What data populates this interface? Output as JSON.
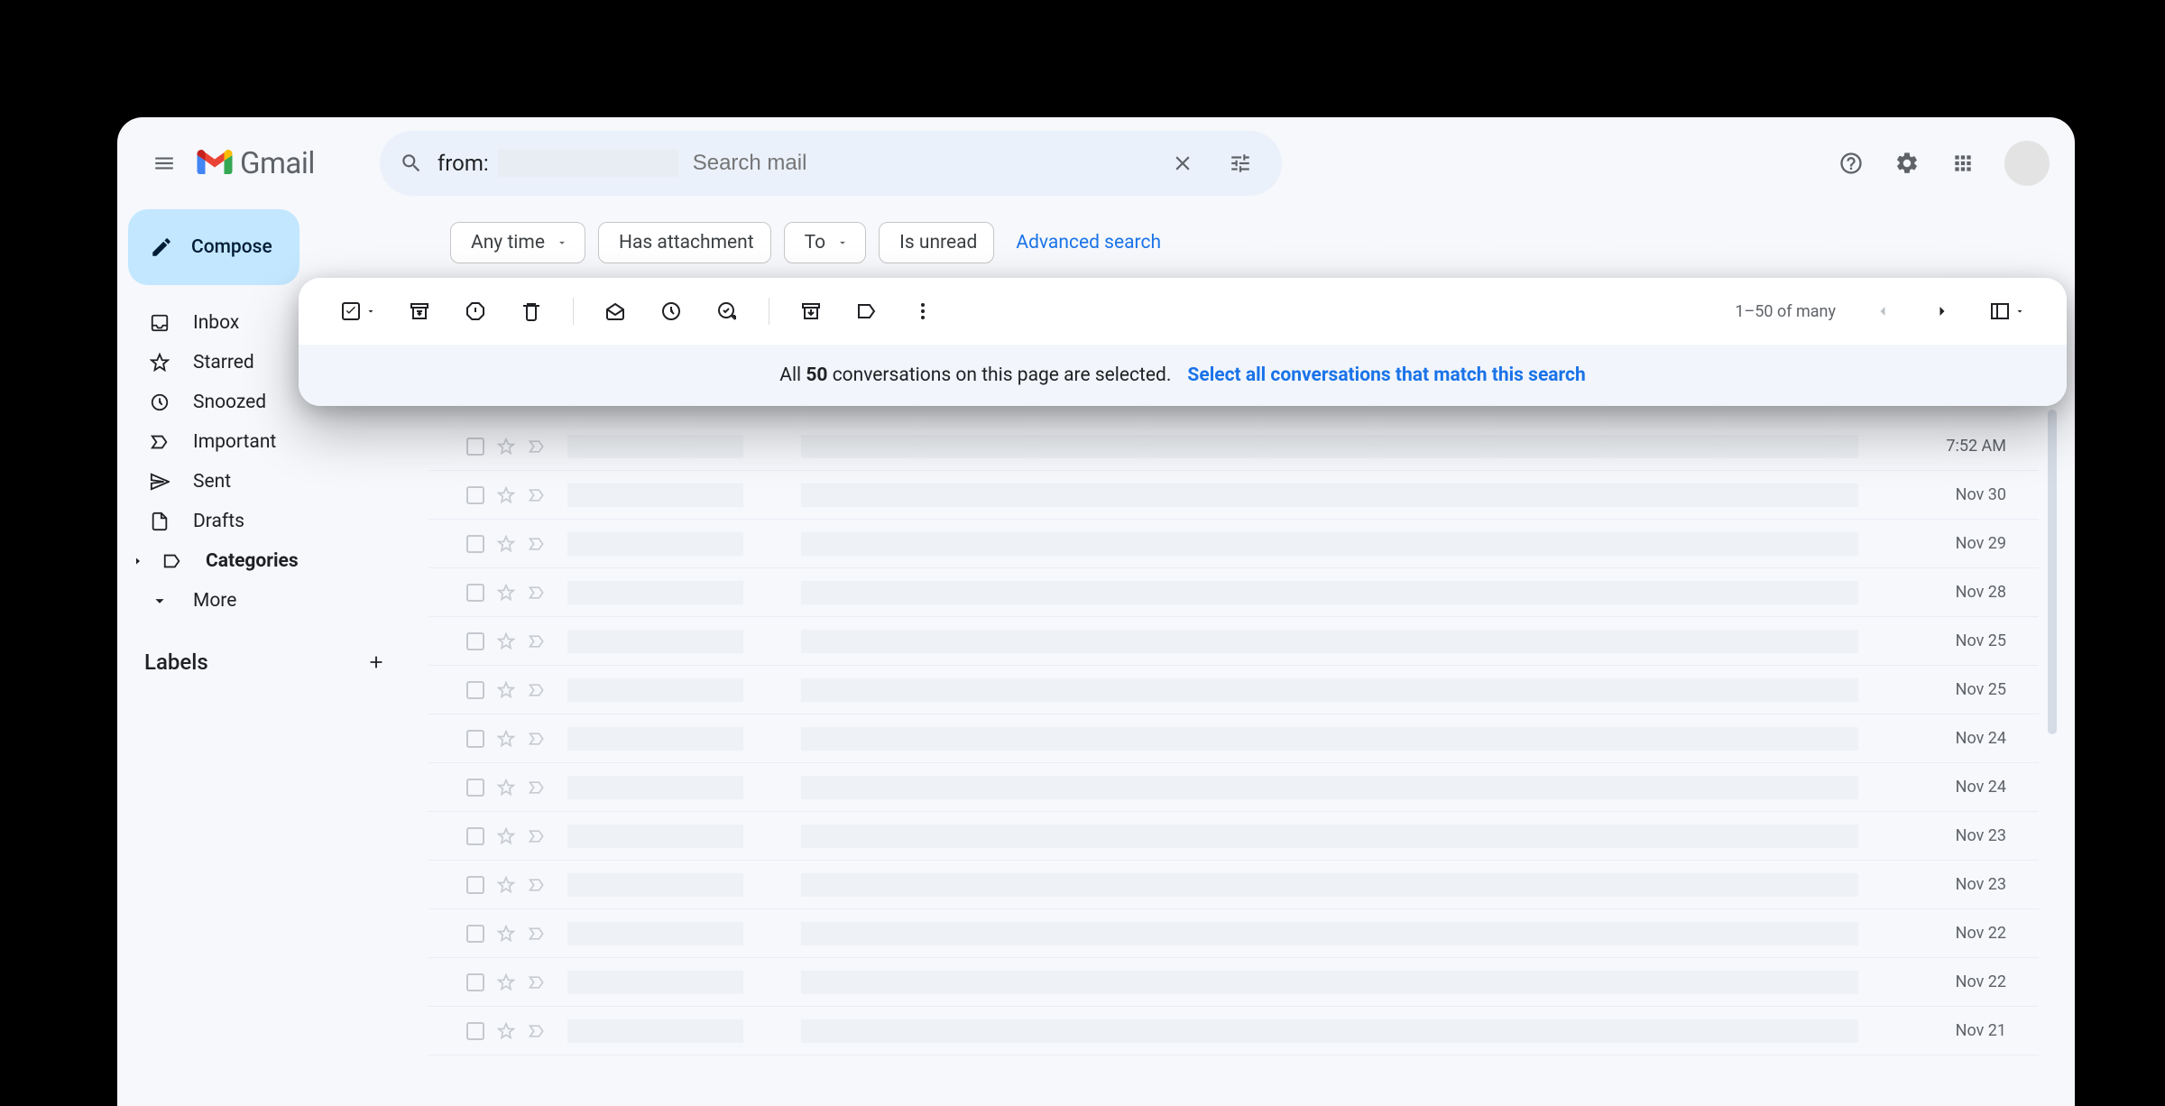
{
  "header": {
    "logo_text": "Gmail",
    "search_query": "from:",
    "search_placeholder": "Search mail"
  },
  "sidebar": {
    "compose_label": "Compose",
    "items": [
      {
        "label": "Inbox",
        "icon": "inbox"
      },
      {
        "label": "Starred",
        "icon": "star"
      },
      {
        "label": "Snoozed",
        "icon": "clock"
      },
      {
        "label": "Important",
        "icon": "important"
      },
      {
        "label": "Sent",
        "icon": "send"
      },
      {
        "label": "Drafts",
        "icon": "draft"
      },
      {
        "label": "Categories",
        "icon": "label",
        "bold": true
      },
      {
        "label": "More",
        "icon": "expand"
      }
    ],
    "labels_heading": "Labels"
  },
  "chips": {
    "any_time": "Any time",
    "has_attachment": "Has attachment",
    "to": "To",
    "is_unread": "Is unread",
    "advanced": "Advanced search"
  },
  "toolbar": {
    "page_info": "1–50 of many"
  },
  "selection_banner": {
    "prefix": "All ",
    "count": "50",
    "suffix": " conversations on this page are selected.",
    "link": "Select all conversations that match this search"
  },
  "mail_rows": [
    {
      "date": "7:52 AM"
    },
    {
      "date": "Nov 30"
    },
    {
      "date": "Nov 29"
    },
    {
      "date": "Nov 28"
    },
    {
      "date": "Nov 25"
    },
    {
      "date": "Nov 25"
    },
    {
      "date": "Nov 24"
    },
    {
      "date": "Nov 24"
    },
    {
      "date": "Nov 23"
    },
    {
      "date": "Nov 23"
    },
    {
      "date": "Nov 22"
    },
    {
      "date": "Nov 22"
    },
    {
      "date": "Nov 21"
    }
  ]
}
